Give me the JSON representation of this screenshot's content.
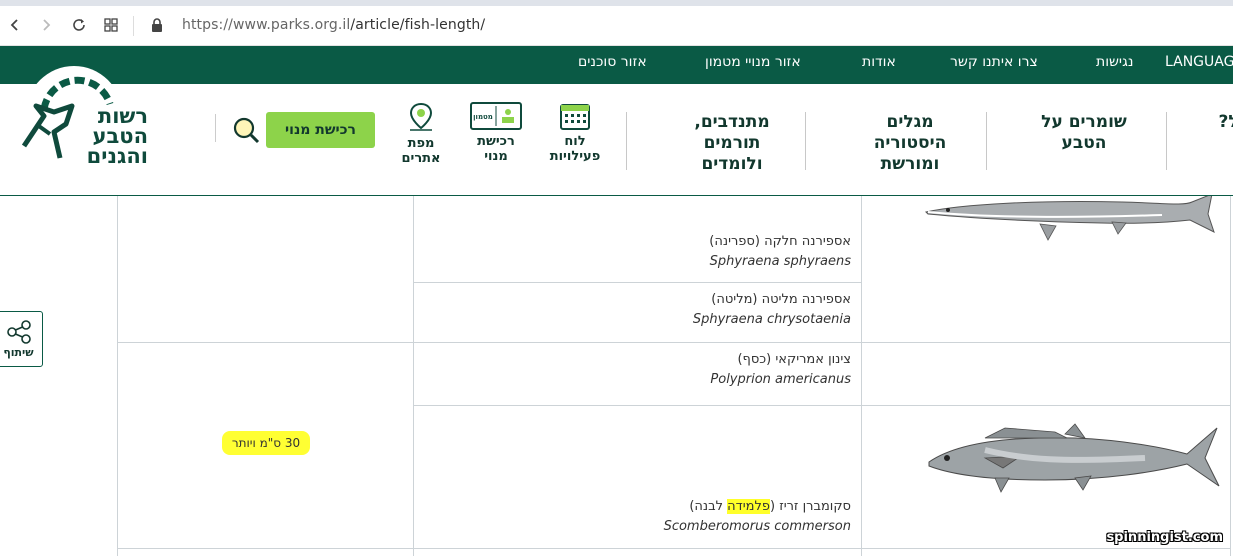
{
  "browser": {
    "url_host": "https://www.parks.org.il",
    "url_path": "/article/fish-length/",
    "back_icon": "chevron-left-icon",
    "forward_icon": "chevron-right-icon",
    "reload_icon": "reload-icon",
    "apps_icon": "grid-icon",
    "lock_icon": "lock-icon"
  },
  "topnav": {
    "items": [
      "LANGUAGE",
      "נגישות",
      "צרו איתנו קשר",
      "אודות",
      "אזור מנויי מטמון",
      "אזור סוכנים"
    ]
  },
  "header": {
    "logo_lines": [
      "רשות",
      "הטבע",
      "והגנים"
    ],
    "register_button": "רכישת מנוי",
    "icons": [
      {
        "label_line1": "מפת",
        "label_line2": "אתרים",
        "icon": "map-pin-icon"
      },
      {
        "label_line1": "רכישת",
        "label_line2": "מנוי",
        "icon": "membership-card-icon",
        "card_text": "מטמון"
      },
      {
        "label_line1": "לוח",
        "label_line2": "פעילויות",
        "icon": "calendar-icon"
      }
    ],
    "menu": [
      {
        "lines": [
          "מתנדבים,",
          "תורמים",
          "ולומדים"
        ]
      },
      {
        "lines": [
          "מגלים",
          "היסטוריה",
          "ומורשת"
        ]
      },
      {
        "lines": [
          "שומרים על",
          "הטבע"
        ]
      },
      {
        "lines": [
          "טיול?"
        ]
      }
    ]
  },
  "share": {
    "label": "שיתוף",
    "icon": "share-icon"
  },
  "table": {
    "rows": [
      {
        "hebrew": "אספירנה חלקה (ספרינה)",
        "latin": "Sphyraena sphyraens"
      },
      {
        "hebrew": "אספירנה מליטה (מליטה)",
        "latin": "Sphyraena chrysotaenia"
      },
      {
        "hebrew": "צינון אמריקאי (כסף)",
        "latin": "Polyprion americanus"
      },
      {
        "hebrew_pre": "סקומברן זריז (",
        "hebrew_highlight": "פלמידה",
        "hebrew_post": " לבנה)",
        "latin": "Scomberomorus  commerson"
      }
    ],
    "size_label": "30 ס\"מ ויותר"
  },
  "watermark": "spinningist.com",
  "colors": {
    "brand_green": "#0a5a45",
    "button_green": "#8dd34a",
    "highlight": "#ffff2a"
  }
}
